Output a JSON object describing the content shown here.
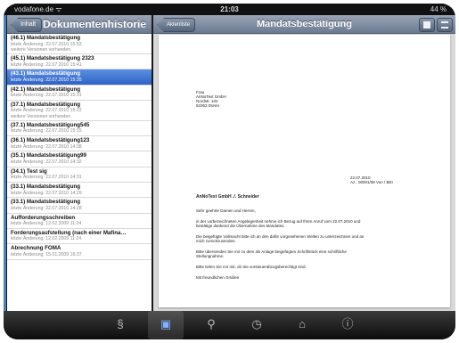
{
  "status": {
    "carrier": "vodafone.de ᯤ",
    "time": "21:03",
    "battery": "44 %"
  },
  "left": {
    "back_label": "Inhalt",
    "title": "Dokumentenhistorie",
    "items": [
      {
        "title": "(46.1) Mandatsbestätigung",
        "sub": "letzte Änderung: 22.07.2010 15:53",
        "sub2": "weitere Versionen vorhanden"
      },
      {
        "title": "(45.1) Mandatsbestätigung 2323",
        "sub": "letzte Änderung: 22.07.2010 15:41",
        "sub2": ""
      },
      {
        "title": "(43.1) Mandatsbestätigung",
        "sub": "letzte Änderung: 22.07.2010 15:35",
        "sub2": ""
      },
      {
        "title": "(42.1) Mandatsbestätigung",
        "sub": "letzte Änderung: 22.07.2010 15:31",
        "sub2": ""
      },
      {
        "title": "(37.1) Mandatsbestätigung",
        "sub": "letzte Änderung: 22.07.2010 15:22",
        "sub2": "weitere Versionen vorhanden"
      },
      {
        "title": "(37.1) Mandatsbestätigung545",
        "sub": "letzte Änderung: 22.07.2010 15:15",
        "sub2": ""
      },
      {
        "title": "(36.1) Mandatsbestätigung123",
        "sub": "letzte Änderung: 22.07.2010 14:38",
        "sub2": ""
      },
      {
        "title": "(35.1) Mandatsbestätigung99",
        "sub": "letzte Änderung: 22.07.2010 14:32",
        "sub2": ""
      },
      {
        "title": "(34.1) Test sig",
        "sub": "letzte Änderung: 22.07.2010 14:31",
        "sub2": ""
      },
      {
        "title": "(33.1) Mandatsbestätigung",
        "sub": "letzte Änderung: 22.07.2010 14:29",
        "sub2": ""
      },
      {
        "title": "(33.1) Mandatsbestätigung",
        "sub": "letzte Änderung: 22.07.2010 14:28",
        "sub2": ""
      },
      {
        "title": "Aufforderungsschreiben",
        "sub": "letzte Änderung: 12.02.2009 11:24",
        "sub2": ""
      },
      {
        "title": "Forderungsaufstellung (nach einer Mafina…",
        "sub": "letzte Änderung: 12.02.2009 11:24",
        "sub2": ""
      },
      {
        "title": "Abrechnung FOMA",
        "sub": "letzte Änderung: 15.01.2009 16:37",
        "sub2": ""
      }
    ]
  },
  "right": {
    "back_label": "Aktenliste",
    "title": "Mandatsbestätigung"
  },
  "doc": {
    "addr1": "Frau",
    "addr2": "AnNoText GmbH",
    "addr3": "Nordstr. 102",
    "addr4": "52353 Düren",
    "date": "22.07.2010",
    "ref": "Az.: 00001/08 Von / BEI",
    "sender": "AnNoText GmbH ./. Schneider",
    "greeting": "Sehr geehrte Damen und Herren,",
    "p1a": "in der vorbezeichneten Angelegenheit nehme ich Bezug auf Ihren Anruf vom 22.07.2010 und",
    "p1b": "bestätige dankend die Übernahme des Mandates.",
    "p2a": "Die beigefügte Vollmacht bitte ich an den dafür vorgesehenen Stellen zu unterzeichnen und an",
    "p2b": "mich zurückzusenden.",
    "p3a": "Bitte übersenden Sie mir zu dem als Anlage beigefügten Schriftstück eine schriftliche",
    "p3b": "Stellungnahme.",
    "p4": "Bitte teilen Sie mir mit, ob Sie vorsteuerabzugsberechtigt sind.",
    "closing": "Mit freundlichen Grüßen"
  },
  "tabs": [
    "§",
    "▣",
    "⚲",
    "◷",
    "⌂",
    "ⓘ"
  ]
}
